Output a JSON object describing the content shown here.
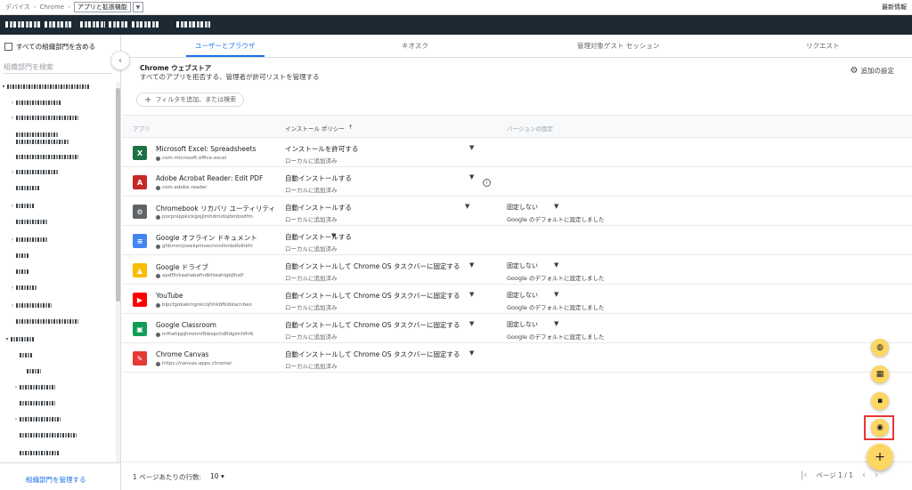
{
  "breadcrumb": {
    "devices": "デバイス",
    "chrome": "Chrome",
    "current": "アプリと拡張機能"
  },
  "topbar": {
    "latest_info": "最新情報"
  },
  "sidebar": {
    "include_all_label": "すべての組織部門を含める",
    "search_placeholder": "組織部門を検索",
    "manage_link": "組織部門を管理する"
  },
  "tabs": [
    {
      "label": "ユーザーとブラウザ",
      "active": true
    },
    {
      "label": "キオスク",
      "active": false
    },
    {
      "label": "管理対象ゲスト セッション",
      "active": false
    },
    {
      "label": "リクエスト",
      "active": false
    }
  ],
  "store": {
    "title": "Chrome ウェブストア",
    "subtitle": "すべてのアプリを拒否する、管理者が許可リストを管理する",
    "extra_settings": "追加の設定",
    "filter_placeholder": "フィルタを追加、または検索"
  },
  "table": {
    "headers": {
      "app": "アプリ",
      "install_policy": "インストール ポリシー",
      "version": "バージョンの固定"
    },
    "rows": [
      {
        "name": "Microsoft Excel: Spreadsheets",
        "id": "com.microsoft.office.excel",
        "policy": "インストールを許可する",
        "policy_sub": "ローカルに追加済み",
        "version": "",
        "version_sub": "",
        "icon": "excel-icon",
        "color": "#1e7145",
        "glyph": "X"
      },
      {
        "name": "Adobe Acrobat Reader: Edit PDF",
        "id": "com.adobe.reader",
        "policy": "自動インストールする",
        "policy_sub": "ローカルに追加済み",
        "version": "",
        "version_sub": "",
        "icon": "acrobat-icon",
        "color": "#c62828",
        "glyph": "A"
      },
      {
        "name": "Chromebook リカバリ ユーティリティ",
        "id": "pocpnlppkickgojjlmhdmidojbmbodfm",
        "policy": "自動インストールする",
        "policy_sub": "ローカルに追加済み",
        "version": "固定しない",
        "version_sub": "Google のデフォルトに設定しました",
        "icon": "recovery-icon",
        "color": "#5f6368",
        "glyph": "⚙"
      },
      {
        "name": "Google オフライン ドキュメント",
        "id": "ghbmnnjooekpmoecnnnilnnbdlolhkhi",
        "policy": "自動インストールする",
        "policy_sub": "ローカルに追加済み",
        "version": "",
        "version_sub": "",
        "icon": "docs-offline-icon",
        "color": "#4285f4",
        "glyph": "≡"
      },
      {
        "name": "Google ドライブ",
        "id": "apdfllckaahabafndbhieahigkjlhalf",
        "policy": "自動インストールして Chrome OS タスクバーに固定する",
        "policy_sub": "ローカルに追加済み",
        "version": "固定しない",
        "version_sub": "Google のデフォルトに設定しました",
        "icon": "drive-icon",
        "color": "#fbbc04",
        "glyph": "▲"
      },
      {
        "name": "YouTube",
        "id": "blpcfgokakmgnkcojhhkbfbldkacnbeo",
        "policy": "自動インストールして Chrome OS タスクバーに固定する",
        "policy_sub": "ローカルに追加済み",
        "version": "固定しない",
        "version_sub": "Google のデフォルトに設定しました",
        "icon": "youtube-icon",
        "color": "#ff0000",
        "glyph": "▶"
      },
      {
        "name": "Google Classroom",
        "id": "mfhehppjhmmnlfbbopchdfldgimhfhfk",
        "policy": "自動インストールして Chrome OS タスクバーに固定する",
        "policy_sub": "ローカルに追加済み",
        "version": "固定しない",
        "version_sub": "Google のデフォルトに設定しました",
        "icon": "classroom-icon",
        "color": "#0f9d58",
        "glyph": "▣"
      },
      {
        "name": "Chrome Canvas",
        "id": "https://canvas.apps.chrome/",
        "policy": "自動インストールして Chrome OS タスクバーに固定する",
        "policy_sub": "ローカルに追加済み",
        "version": "",
        "version_sub": "",
        "icon": "canvas-icon",
        "color": "#e53935",
        "glyph": "✎"
      }
    ]
  },
  "pagination": {
    "rows_per_page_label": "1 ページあたりの行数:",
    "rows_per_page_value": "10",
    "page_label": "ページ 1 / 1"
  },
  "fabs": [
    {
      "name": "globe-fab",
      "glyph": "🌐"
    },
    {
      "name": "apps-fab",
      "glyph": "▦"
    },
    {
      "name": "android-fab",
      "glyph": "⬛"
    },
    {
      "name": "chrome-fab",
      "glyph": "◉"
    }
  ],
  "colors": {
    "accent": "#1a73e8",
    "fab": "#fdd663",
    "header": "#1e2a33",
    "highlight": "#e53935"
  }
}
